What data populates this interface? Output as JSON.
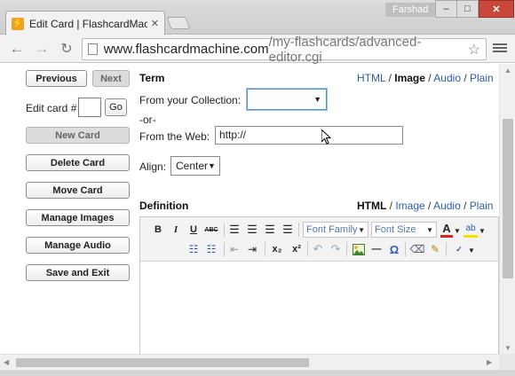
{
  "browser": {
    "tab_title": "Edit Card | FlashcardMachine",
    "favicon_glyph": "⚡",
    "close_glyph": "✕",
    "user": "Farshad",
    "min_glyph": "‒",
    "max_glyph": "□",
    "close_win_glyph": "✕",
    "url_host": "www.flashcardmachine.com",
    "url_path": "/my-flashcards/advanced-editor.cgi",
    "star_glyph": "☆",
    "back_glyph": "←",
    "forward_glyph": "→",
    "reload_glyph": "↻"
  },
  "sidebar": {
    "previous_label": "Previous",
    "next_label": "Next",
    "edit_card_label": "Edit card #",
    "edit_card_value": "",
    "go_label": "Go",
    "new_card_label": "New Card",
    "delete_card_label": "Delete Card",
    "move_card_label": "Move Card",
    "manage_images_label": "Manage Images",
    "manage_audio_label": "Manage Audio",
    "save_exit_label": "Save and Exit"
  },
  "term": {
    "title": "Term",
    "mode_html": "HTML",
    "mode_image": "Image",
    "mode_audio": "Audio",
    "mode_plain": "Plain",
    "separator": "/",
    "active_mode": "Image",
    "collection_label": "From your Collection:",
    "collection_value": "",
    "or_label": "-or-",
    "web_label": "From the Web:",
    "web_value": "http://",
    "align_label": "Align:",
    "align_value": "Center"
  },
  "definition": {
    "title": "Definition",
    "mode_html": "HTML",
    "mode_image": "Image",
    "mode_audio": "Audio",
    "mode_plain": "Plain",
    "separator": "/",
    "active_mode": "HTML",
    "font_family_label": "Font Family",
    "font_size_label": "Font Size",
    "bold_glyph": "B",
    "italic_glyph": "I",
    "underline_glyph": "U",
    "strike_glyph": "ABC",
    "subscript_glyph": "x₂",
    "superscript_glyph": "x²",
    "omega_glyph": "Ω",
    "hr_glyph": "—",
    "font_color_glyph": "A"
  }
}
